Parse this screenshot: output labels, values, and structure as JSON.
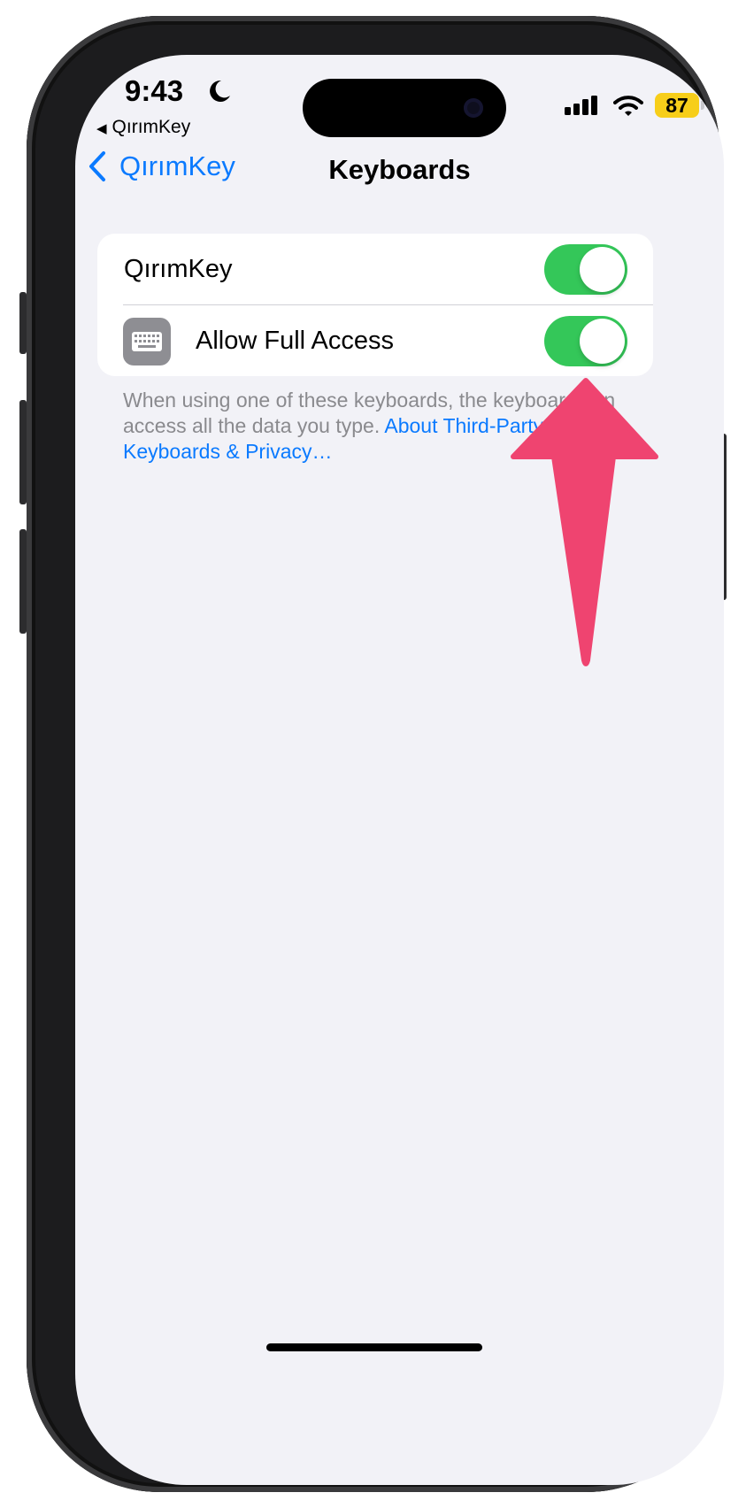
{
  "status_bar": {
    "time": "9:43",
    "return_app": "QırımKey",
    "battery_percent": "87",
    "focus_mode_icon": "moon-icon",
    "signal_icon": "cellular-signal-icon",
    "wifi_icon": "wifi-icon"
  },
  "nav": {
    "back_label": "QırımKey",
    "title": "Keyboards"
  },
  "settings": {
    "rows": [
      {
        "label": "QırımKey",
        "toggle_on": true
      },
      {
        "label": "Allow Full Access",
        "icon": "keyboard-icon",
        "toggle_on": true
      }
    ]
  },
  "footer": {
    "text": "When using one of these keyboards, the keyboard can access all the data you type. ",
    "link": "About Third-Party Keyboards & Privacy…"
  },
  "colors": {
    "accent": "#0a7aff",
    "toggle_on": "#34c759",
    "annotation_arrow": "#ef4470",
    "battery": "#f7ce1a"
  }
}
